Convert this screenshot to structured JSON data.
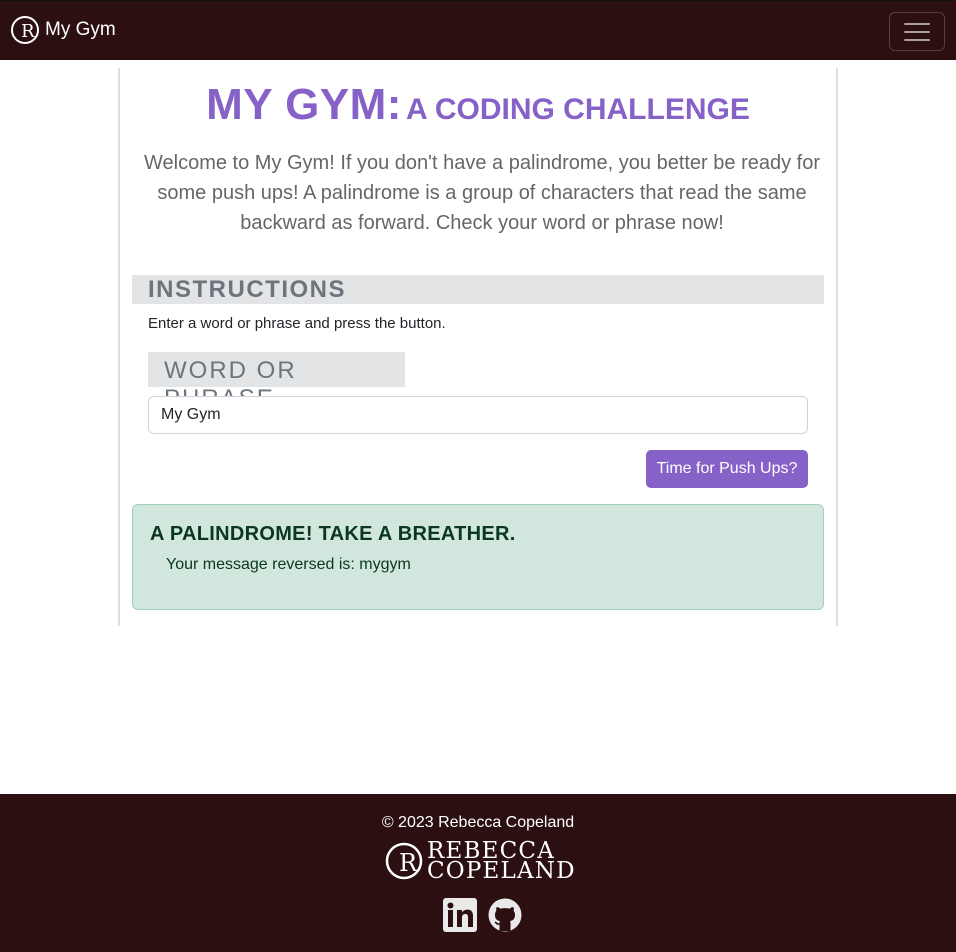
{
  "navbar": {
    "brand_text": "My Gym",
    "brand_logo_icon": "rc-monogram-icon",
    "menu_icon": "hamburger-menu-icon"
  },
  "page": {
    "title_main": "MY GYM:",
    "title_sub": "A CODING CHALLENGE",
    "intro": "Welcome to My Gym! If you don't have a palindrome, you better be ready for some push ups! A palindrome is a group of characters that read the same backward as forward. Check your word or phrase now!",
    "instructions_heading": "INSTRUCTIONS",
    "instructions_text": "Enter a word or phrase and press the button.",
    "input_label": "WORD OR PHRASE",
    "input_value": "My Gym",
    "submit_label": "Time for Push Ups?"
  },
  "result": {
    "heading": "A PALINDROME! TAKE A BREATHER.",
    "message": "Your message reversed is: mygym"
  },
  "footer": {
    "copyright": "© 2023 Rebecca Copeland",
    "logo_line1": "REBECCA",
    "logo_line2": "COPELAND",
    "social_icons": [
      "linkedin-icon",
      "github-icon"
    ]
  },
  "colors": {
    "navbar_bg": "#2b0f11",
    "accent": "#8661c7",
    "success_bg": "#d1e7dd",
    "success_text": "#0a3622"
  }
}
